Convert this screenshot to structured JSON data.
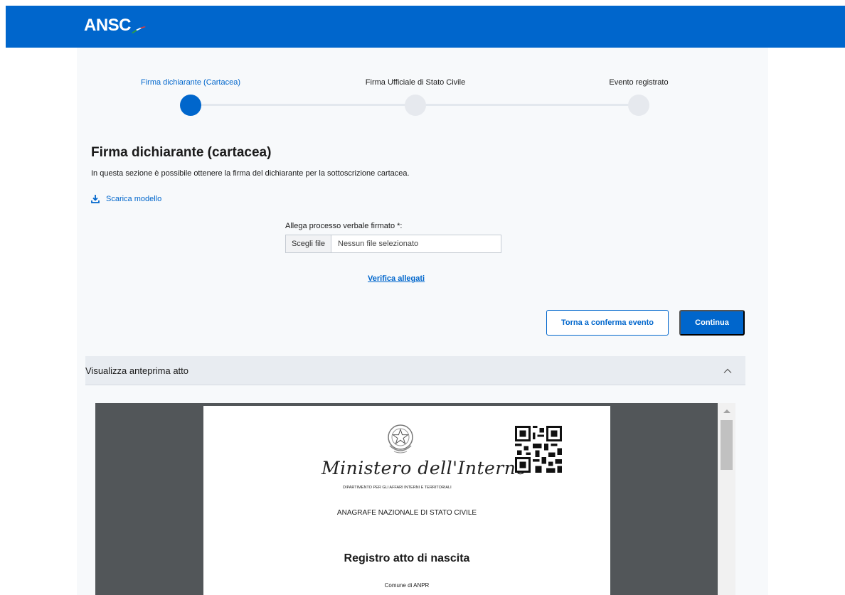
{
  "header": {
    "logo_text": "ANSC",
    "brand_color": "#0066cc"
  },
  "stepper": {
    "steps": [
      {
        "label": "Firma dichiarante (Cartacea)",
        "state": "active"
      },
      {
        "label": "Firma Ufficiale di Stato Civile",
        "state": "pending"
      },
      {
        "label": "Evento registrato",
        "state": "pending"
      }
    ]
  },
  "section": {
    "title": "Firma dichiarante (cartacea)",
    "description": "In questa sezione è possibile ottenere la firma del dichiarante per la sottoscrizione cartacea.",
    "download_label": "Scarica modello",
    "download_icon": "download-icon"
  },
  "upload": {
    "label": "Allega processo verbale firmato *:",
    "button_label": "Scegli file",
    "file_status": "Nessun file selezionato"
  },
  "verify_link": "Verifica allegati",
  "actions": {
    "back_label": "Torna a conferma evento",
    "continue_label": "Continua"
  },
  "preview": {
    "title": "Visualizza anteprima atto",
    "expanded": true,
    "chevron_icon": "chevron-up-icon"
  },
  "document": {
    "ministry": "Ministero dell'Interno",
    "department": "DIPARTIMENTO PER GLI AFFARI INTERNI E TERRITORIALI",
    "registry": "ANAGRAFE NAZIONALE DI STATO CIVILE",
    "title": "Registro atto di nascita",
    "municipality": "Comune di ANPR"
  }
}
